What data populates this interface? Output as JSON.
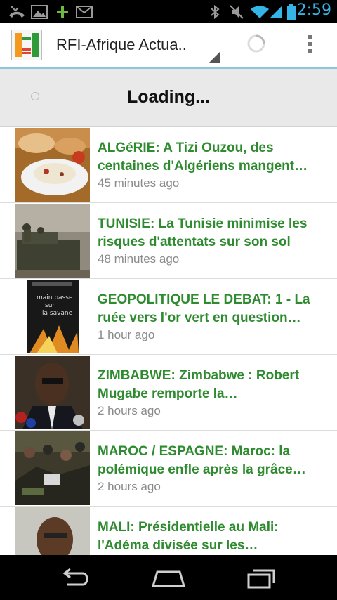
{
  "status_bar": {
    "time": "2:59",
    "icons": [
      "missed-call-icon",
      "image-icon",
      "plus-icon",
      "gmail-icon",
      "bluetooth-icon",
      "mute-icon",
      "wifi-icon",
      "signal-icon",
      "battery-icon"
    ]
  },
  "action_bar": {
    "title": "RFI-Afrique Actua..",
    "logo_icon": "app-logo-icon",
    "menu_icon": "overflow-menu-icon"
  },
  "loading": {
    "text": "Loading..."
  },
  "articles": [
    {
      "title": "ALGéRIE: A Tizi Ouzou, des centaines d'Algériens mangent…",
      "time": "45 minutes ago",
      "thumb": "food-photo"
    },
    {
      "title": "TUNISIE: La Tunisie minimise les risques d'attentats sur son sol",
      "time": "48 minutes ago",
      "thumb": "soldiers-photo"
    },
    {
      "title": "GEOPOLITIQUE LE DEBAT: 1 - La ruée vers l'or vert en question…",
      "time": "1 hour ago",
      "thumb": "book-cover-photo"
    },
    {
      "title": "ZIMBABWE: Zimbabwe : Robert Mugabe remporte la…",
      "time": "2 hours ago",
      "thumb": "mugabe-photo"
    },
    {
      "title": "MAROC / ESPAGNE: Maroc: la polémique enfle après la grâce…",
      "time": "2 hours ago",
      "thumb": "police-crowd-photo"
    },
    {
      "title": "MALI: Présidentielle au Mali: l'Adéma divisée sur les…",
      "time": "",
      "thumb": "man-portrait-photo"
    }
  ],
  "nav_bar": {
    "icons": [
      "back-icon",
      "home-icon",
      "recent-apps-icon"
    ]
  }
}
